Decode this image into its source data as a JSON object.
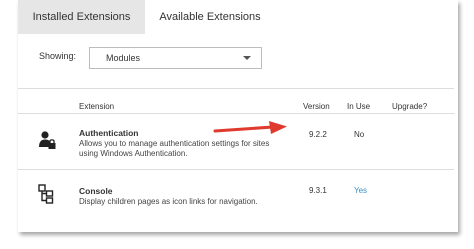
{
  "tabs": [
    {
      "label": "Installed Extensions",
      "active": true
    },
    {
      "label": "Available Extensions",
      "active": false
    }
  ],
  "filter": {
    "label": "Showing:",
    "selected": "Modules"
  },
  "table": {
    "headers": {
      "extension": "Extension",
      "version": "Version",
      "in_use": "In Use",
      "upgrade": "Upgrade?"
    },
    "rows": [
      {
        "icon": "user-lock-icon",
        "name": "Authentication",
        "description_line1": "Allows you to manage authentication settings for sites",
        "description_line2": "using Windows Authentication.",
        "version": "9.2.2",
        "in_use": "No"
      },
      {
        "icon": "pages-tree-icon",
        "name": "Console",
        "description_line1": "Display children pages as icon links for navigation.",
        "description_line2": "",
        "version": "9.3.1",
        "in_use": "Yes"
      }
    ]
  },
  "colors": {
    "arrow": "#e03a2f",
    "link_blue": "#3a8fc9",
    "active_tab": "#e6e6e6"
  }
}
